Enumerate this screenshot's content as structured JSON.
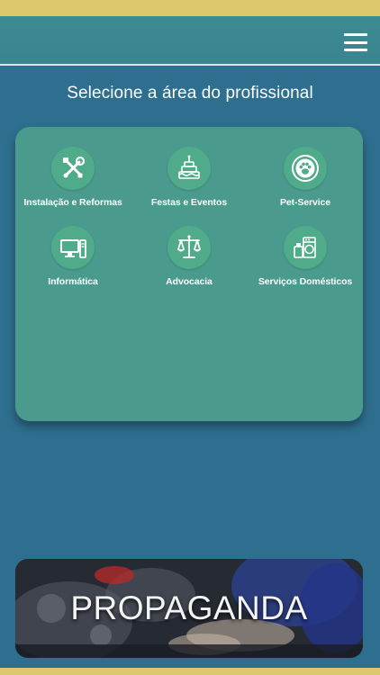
{
  "header": {
    "menu_icon": "hamburger-menu-icon"
  },
  "page": {
    "title": "Selecione a área do profissional"
  },
  "categories": [
    {
      "label": "Instalação e Reformas",
      "icon": "tools-icon"
    },
    {
      "label": "Festas e Eventos",
      "icon": "cake-icon"
    },
    {
      "label": "Pet-Service",
      "icon": "paw-icon"
    },
    {
      "label": "Informática",
      "icon": "computer-icon"
    },
    {
      "label": "Advocacia",
      "icon": "scales-icon"
    },
    {
      "label": "Serviços Domésticos",
      "icon": "appliances-icon"
    }
  ],
  "ad_banner": {
    "text": "PROPAGANDA"
  },
  "colors": {
    "background": "#2e6f8f",
    "header": "#3d8a93",
    "card": "#4a9a8d",
    "icon_circle": "#4fab8a",
    "accent_strip": "#dcc86a"
  }
}
